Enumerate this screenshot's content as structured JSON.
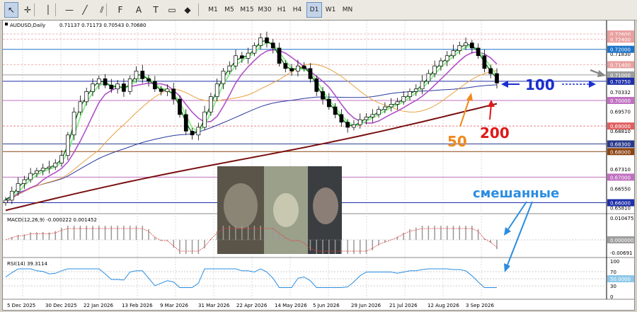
{
  "toolbar": {
    "timeframes": [
      "M1",
      "M5",
      "M15",
      "M30",
      "H1",
      "H4",
      "D1",
      "W1",
      "MN"
    ],
    "active_timeframe": "D1",
    "tool_icons": [
      "cursor-icon",
      "crosshair-icon",
      "vertical-line-icon",
      "horizontal-line-icon",
      "trendline-icon",
      "equidistant-channel-icon",
      "fibonacci-icon",
      "text-icon",
      "text-label-icon",
      "rectangle-icon",
      "arrow-marker-icon"
    ]
  },
  "chart_header": {
    "symbol_label": "AUDUSD,Daily",
    "ohlc": "0.71137 0.71173 0.70543 0.70680"
  },
  "price_axis": {
    "labels": [
      "0.72600",
      "0.72400",
      "0.71830",
      "0.71400",
      "0.71000",
      "0.70332",
      "0.69570",
      "0.68810",
      "0.67310",
      "0.66550",
      "0.65810"
    ],
    "highlighted_labels": [
      {
        "text": "0.72600",
        "color": "#e8a0a0",
        "price": 0.726
      },
      {
        "text": "0.72400",
        "color": "#e8a0a0",
        "price": 0.724
      },
      {
        "text": "0.72000",
        "color": "#1e73c8",
        "price": 0.72
      },
      {
        "text": "0.71400",
        "color": "#e8a0a0",
        "price": 0.714
      },
      {
        "text": "0.71000",
        "color": "#9e9e9e",
        "price": 0.71
      },
      {
        "text": "0.70750",
        "color": "#1e2fa8",
        "price": 0.7075
      },
      {
        "text": "0.70000",
        "color": "#c070c0",
        "price": 0.7
      },
      {
        "text": "0.69000",
        "color": "#e06060",
        "price": 0.69
      },
      {
        "text": "0.68300",
        "color": "#2a3a8c",
        "price": 0.683
      },
      {
        "text": "0.68000",
        "color": "#8b4513",
        "price": 0.68
      },
      {
        "text": "0.67000",
        "color": "#c070c0",
        "price": 0.67
      },
      {
        "text": "0.66000",
        "color": "#1e2fa8",
        "price": 0.66
      }
    ]
  },
  "macd": {
    "label": "MACD(12,26,9) -0.000222 0.001452",
    "axis_labels": [
      "0.010475",
      "0.000000",
      "-0.00691"
    ]
  },
  "rsi": {
    "label": "RSI(14) 39.3114",
    "axis_labels": [
      "100",
      "70",
      "30",
      "0"
    ],
    "value_label": "50.0000"
  },
  "time_axis": {
    "labels": [
      "5 Dec 2025",
      "30 Dec 2025",
      "22 Jan 2026",
      "13 Feb 2026",
      "9 Mar 2026",
      "31 Mar 2026",
      "22 Apr 2026",
      "14 May 2026",
      "5 Jun 2026",
      "29 Jun 2026",
      "21 Jul 2026",
      "12 Aug 2026",
      "3 Sep 2026"
    ]
  },
  "annotations": {
    "label_100": "100",
    "label_50": "50",
    "label_200": "200",
    "label_mixed": "смешанные",
    "colors": {
      "label_100": "#1a2ed0",
      "label_50": "#f08a1c",
      "label_200": "#e01818",
      "label_mixed": "#2a8de0"
    }
  },
  "inset_image": {
    "description_icon": "banknote-collage-image"
  },
  "colors": {
    "candle": "#000000",
    "ma_fast": "#0a7a0a",
    "ma_light": "#90ee90",
    "ma_purple": "#b050c8",
    "ma_50": "#e8a040",
    "ma_100": "#2a3a9c",
    "ma_200": "#7a1010"
  },
  "chart_data": {
    "type": "candlestick",
    "symbol": "AUDUSD",
    "timeframe": "Daily",
    "ylim": [
      0.656,
      0.7285
    ],
    "x": [
      "5 Dec 2025",
      "30 Dec 2025",
      "22 Jan 2026",
      "13 Feb 2026",
      "9 Mar 2026",
      "31 Mar 2026",
      "22 Apr 2026",
      "14 May 2026",
      "5 Jun 2026",
      "29 Jun 2026",
      "21 Jul 2026",
      "12 Aug 2026",
      "3 Sep 2026"
    ],
    "close_path": [
      0.661,
      0.6645,
      0.6675,
      0.669,
      0.6715,
      0.6725,
      0.6735,
      0.674,
      0.6755,
      0.6785,
      0.6865,
      0.6955,
      0.6995,
      0.7035,
      0.7065,
      0.7085,
      0.706,
      0.7045,
      0.7065,
      0.7035,
      0.7085,
      0.7115,
      0.7085,
      0.7075,
      0.7045,
      0.7035,
      0.7045,
      0.7005,
      0.6945,
      0.688,
      0.6865,
      0.6895,
      0.6955,
      0.7015,
      0.7065,
      0.7115,
      0.7135,
      0.7175,
      0.7165,
      0.7185,
      0.7215,
      0.7245,
      0.7225,
      0.7205,
      0.7145,
      0.7125,
      0.7115,
      0.7135,
      0.7125,
      0.7085,
      0.7035,
      0.7005,
      0.6975,
      0.6945,
      0.6915,
      0.6895,
      0.6905,
      0.6925,
      0.6935,
      0.6945,
      0.6965,
      0.6975,
      0.6985,
      0.6995,
      0.7015,
      0.7035,
      0.7045,
      0.7075,
      0.7105,
      0.7135,
      0.7155,
      0.7175,
      0.7195,
      0.7215,
      0.7225,
      0.7205,
      0.7175,
      0.7125,
      0.7105,
      0.7068
    ],
    "ma_levels": {
      "ma_100_last": 0.7075,
      "ma_50_last": 0.7045,
      "ma_200_last": 0.6985
    }
  }
}
